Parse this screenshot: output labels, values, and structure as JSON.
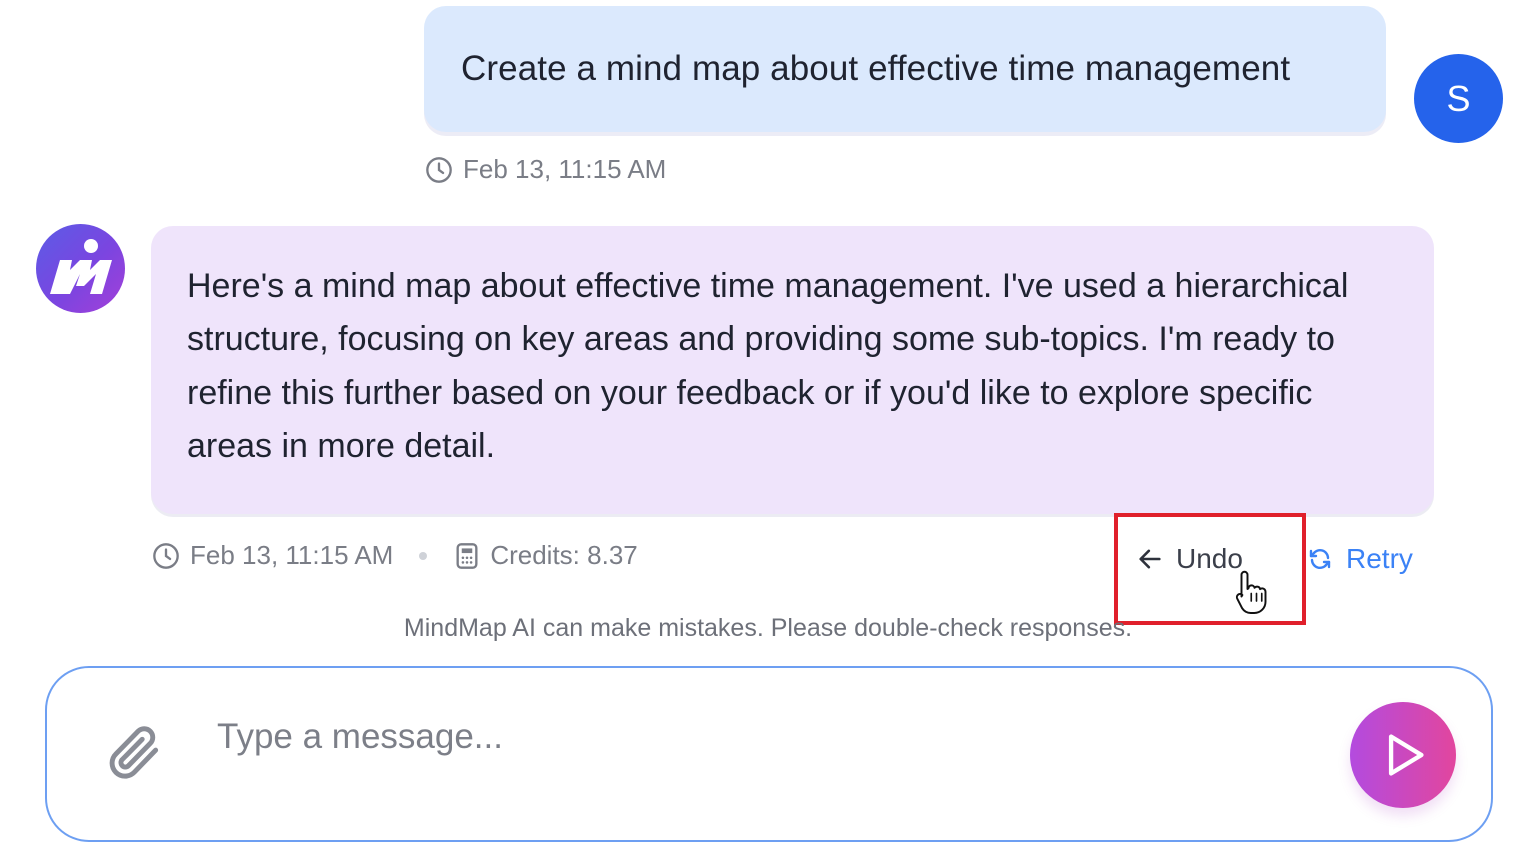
{
  "user_message": {
    "text": "Create a mind map about effective time management",
    "avatar_initial": "S",
    "timestamp": "Feb 13, 11:15 AM"
  },
  "ai_message": {
    "text": "Here's a mind map about effective time management. I've used a hierarchical structure, focusing on key areas and providing some sub-topics. I'm ready to refine this further based on your feedback or if you'd like to explore specific areas in more detail.",
    "timestamp": "Feb 13, 11:15 AM",
    "credits": "Credits: 8.37"
  },
  "actions": {
    "undo_label": "Undo",
    "retry_label": "Retry"
  },
  "disclaimer": "MindMap AI can make mistakes. Please double-check responses.",
  "composer": {
    "placeholder": "Type a message..."
  },
  "colors": {
    "user_bubble": "#dbe9fd",
    "ai_bubble": "#efe4fb",
    "user_avatar": "#2563eb",
    "retry_accent": "#3b82f6",
    "highlight_box": "#e0202b",
    "composer_border": "#6d9ff2"
  },
  "icons": {
    "timestamp": "clock-icon",
    "credits": "calculator-icon",
    "undo": "arrow-left-icon",
    "retry": "refresh-icon",
    "attach": "paperclip-icon",
    "send": "play-triangle-icon",
    "pointer": "hand-cursor-icon"
  }
}
